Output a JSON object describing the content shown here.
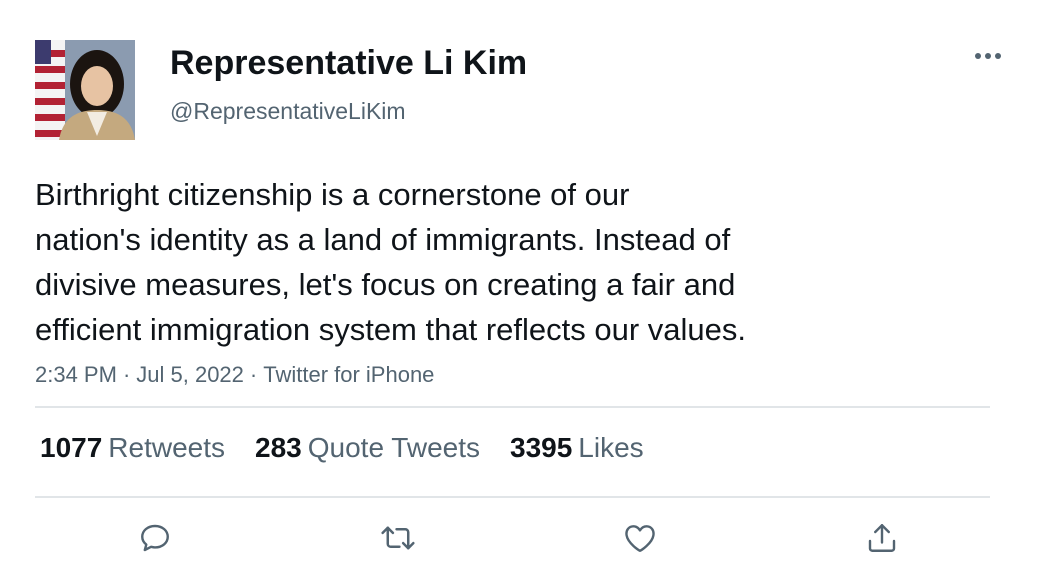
{
  "author": {
    "display_name": "Representative Li Kim",
    "handle": "@RepresentativeLiKim"
  },
  "tweet": {
    "text_lines": [
      "Birthright citizenship is a cornerstone of our",
      "nation's identity as a land of immigrants. Instead of",
      "divisive measures, let's focus on creating a fair and",
      "efficient immigration system that reflects our values."
    ],
    "time": "2:34 PM",
    "date": "Jul 5, 2022",
    "source": "Twitter for iPhone",
    "separator": "·"
  },
  "stats": {
    "retweets": {
      "count": "1077",
      "label": "Retweets"
    },
    "quote_tweets": {
      "count": "283",
      "label": "Quote Tweets"
    },
    "likes": {
      "count": "3395",
      "label": "Likes"
    }
  },
  "icons": {
    "more": "more-horizontal-icon",
    "reply": "reply-bubble-icon",
    "retweet": "retweet-icon",
    "like": "heart-icon",
    "share": "share-icon"
  },
  "colors": {
    "text": "#0f1419",
    "secondary": "#536471",
    "divider": "#e1e5e8"
  }
}
